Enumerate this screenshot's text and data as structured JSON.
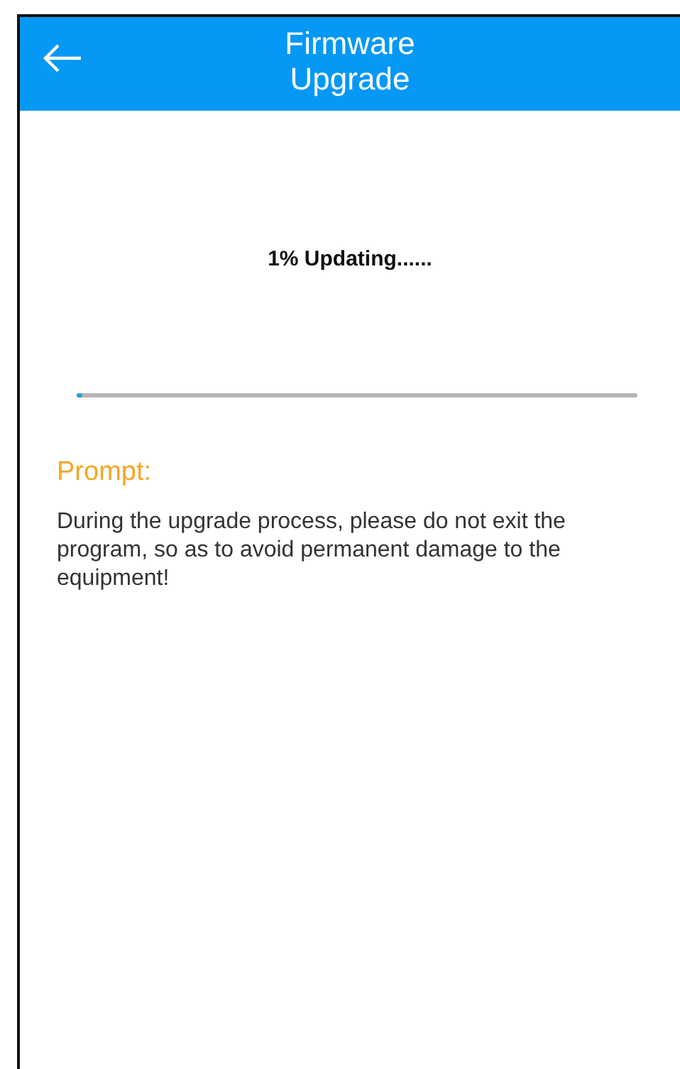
{
  "header": {
    "title": "Firmware Upgrade"
  },
  "progress": {
    "status": "1% Updating......",
    "level": 0.01
  },
  "prompt": {
    "heading": "Prompt:",
    "message": "During the upgrade process, please do not exit the program, so as to avoid permanent damage to the equipment!"
  }
}
